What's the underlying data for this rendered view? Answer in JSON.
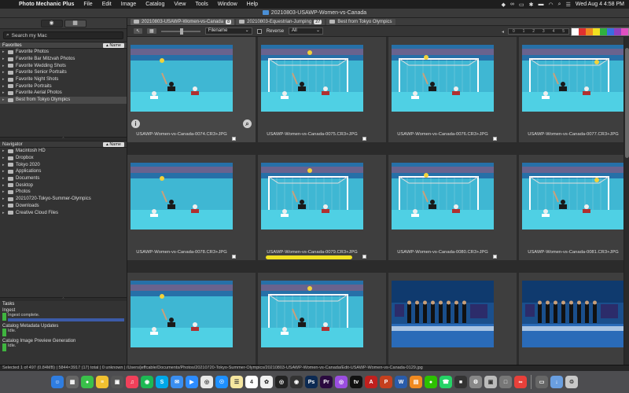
{
  "menubar": {
    "app": "Photo Mechanic Plus",
    "items": [
      "File",
      "Edit",
      "Image",
      "Catalog",
      "View",
      "Tools",
      "Window",
      "Help"
    ],
    "clock": "Wed Aug 4  4:58 PM"
  },
  "window": {
    "title": "20210803-USAWP-Women-vs-Canada"
  },
  "left": {
    "search_placeholder": "Search my Mac",
    "favorites_title": "Favorites",
    "name_button": "▴ Name",
    "favorites": [
      "Favorite Photos",
      "Favorite Bar Mitzvah Photos",
      "Favorite Wedding Shots",
      "Favorite Senior Portraits",
      "Favorite Night Shots",
      "Favorite Portraits",
      "Favorite Aerial Photos",
      "Best from Tokyo Olympics"
    ],
    "navigator_title": "Navigator",
    "navigator": [
      "Macintosh HD",
      "Dropbox",
      "Tokyo 2020",
      "Applications",
      "Documents",
      "Desktop",
      "Photos",
      "20210720-Tokyo-Summer-Olympics",
      "Downloads",
      "Creative Cloud Files"
    ],
    "tasks_title": "Tasks",
    "tasks": [
      {
        "name": "Ingest",
        "status": "Ingest complete."
      },
      {
        "name": "Catalog Metadata Updates",
        "status": "Idle."
      },
      {
        "name": "Catalog Image Preview Generation",
        "status": "Idle."
      }
    ]
  },
  "tabs": [
    {
      "label": "20210803-USAWP-Women-vs-Canada",
      "count": "8"
    },
    {
      "label": "20210803-Equestrian-Jumping",
      "count": "27"
    },
    {
      "label": "Best from Tokyo Olympics",
      "count": ""
    }
  ],
  "toolbar": {
    "sort": "Filename",
    "reverse": "Reverse",
    "filter": "All",
    "stars": [
      "0",
      "1",
      "2",
      "3",
      "4",
      "5"
    ]
  },
  "color_labels": [
    "#ffffff",
    "#e03030",
    "#f08a20",
    "#f0e020",
    "#30b040",
    "#3a6ee0",
    "#9040c0",
    "#e050c0",
    "#909090"
  ],
  "photos": [
    "USAWP-Women-vs-Canada-0074.CR3+JPG",
    "USAWP-Women-vs-Canada-0075.CR3+JPG",
    "USAWP-Women-vs-Canada-0076.CR3+JPG",
    "USAWP-Women-vs-Canada-0077.CR3+JPG",
    "USAWP-Women-vs-Canada-0078.CR3+JPG",
    "USAWP-Women-vs-Canada-0079.CR3+JPG",
    "USAWP-Women-vs-Canada-0080.CR3+JPG",
    "USAWP-Women-vs-Canada-0081.CR3+JPG"
  ],
  "status": "Selected 1 of 497 (0.84MB) | 5844×3917 (17) total | 0 unknown | /Users/jeffcable/Documents/Photos/20210720-Tokyo-Summer-Olympics/20210803-USAWP-Women-vs-Canada/Edit-USAWP-Women-vs-Canada-0129.jpg",
  "dock": [
    {
      "icon": "finder-icon",
      "color": "#2f7de0",
      "glyph": "☺"
    },
    {
      "icon": "launchpad-icon",
      "color": "#666",
      "glyph": "▦"
    },
    {
      "icon": "messages-icon",
      "color": "#3ac04a",
      "glyph": "●"
    },
    {
      "icon": "notes-icon",
      "color": "#f0c030",
      "glyph": "≡"
    },
    {
      "icon": "preview-icon",
      "color": "#555",
      "glyph": "▣"
    },
    {
      "icon": "music-icon",
      "color": "#f0405a",
      "glyph": "♫"
    },
    {
      "icon": "spotify-icon",
      "color": "#1db954",
      "glyph": "◉"
    },
    {
      "icon": "skype-icon",
      "color": "#00a8e8",
      "glyph": "S"
    },
    {
      "icon": "mail-icon",
      "color": "#3a8ef0",
      "glyph": "✉"
    },
    {
      "icon": "zoom-icon",
      "color": "#2d8cff",
      "glyph": "▶"
    },
    {
      "icon": "chrome-icon",
      "color": "#e8e8e8",
      "glyph": "◎"
    },
    {
      "icon": "safari-icon",
      "color": "#1e90ff",
      "glyph": "☉"
    },
    {
      "icon": "notes2-icon",
      "color": "#f5e6a0",
      "glyph": "☰"
    },
    {
      "icon": "calendar-icon",
      "color": "#ffffff",
      "glyph": "4"
    },
    {
      "icon": "photos-icon",
      "color": "#f0f0f0",
      "glyph": "✿"
    },
    {
      "icon": "camera-raw-icon",
      "color": "#222",
      "glyph": "◎"
    },
    {
      "icon": "obs-icon",
      "color": "#333",
      "glyph": "◉"
    },
    {
      "icon": "photoshop-icon",
      "color": "#0d2a52",
      "glyph": "Ps"
    },
    {
      "icon": "premiere-icon",
      "color": "#2a0a3f",
      "glyph": "Pr"
    },
    {
      "icon": "podcasts-icon",
      "color": "#9b4ee0",
      "glyph": "◎"
    },
    {
      "icon": "appletv-icon",
      "color": "#111",
      "glyph": "tv"
    },
    {
      "icon": "acrobat-icon",
      "color": "#c0201e",
      "glyph": "A"
    },
    {
      "icon": "powerpoint-icon",
      "color": "#c5401e",
      "glyph": "P"
    },
    {
      "icon": "word-icon",
      "color": "#2a5caa",
      "glyph": "W"
    },
    {
      "icon": "books-icon",
      "color": "#f08a20",
      "glyph": "▤"
    },
    {
      "icon": "wechat-icon",
      "color": "#2dc100",
      "glyph": "●"
    },
    {
      "icon": "whatsapp-icon",
      "color": "#25d366",
      "glyph": "☎"
    },
    {
      "icon": "facetime-icon",
      "color": "#333",
      "glyph": "■"
    },
    {
      "icon": "systemprefs-icon",
      "color": "#888",
      "glyph": "⚙"
    },
    {
      "icon": "preview2-icon",
      "color": "#bbb",
      "glyph": "▣"
    },
    {
      "icon": "viewer-icon",
      "color": "#777",
      "glyph": "□"
    },
    {
      "icon": "creative-cloud-icon",
      "color": "#e8403a",
      "glyph": "∞"
    },
    {
      "icon": "screen-icon",
      "color": "#666",
      "glyph": "▭"
    },
    {
      "icon": "downloads-icon",
      "color": "#6a9fe0",
      "glyph": "↓"
    },
    {
      "icon": "trash-icon",
      "color": "#c8c8c8",
      "glyph": "♲"
    }
  ]
}
